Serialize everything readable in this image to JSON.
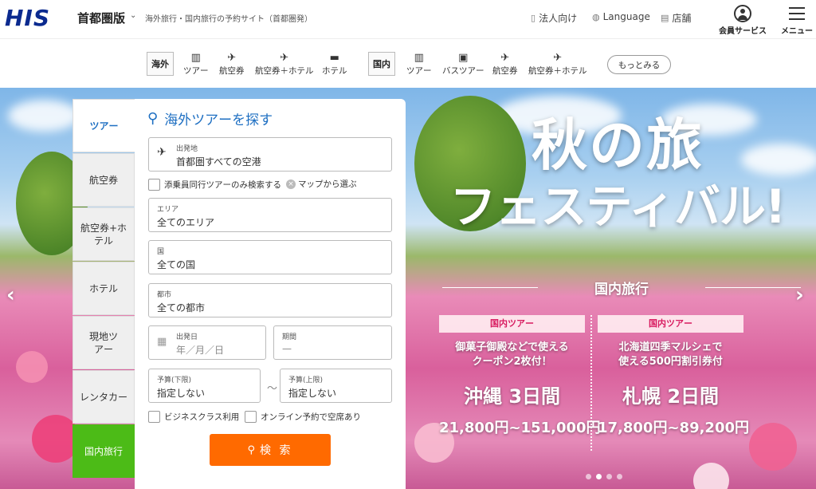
{
  "header": {
    "logo": "HIS",
    "region": "首都圏版",
    "tagline": "海外旅行・国内旅行の予約サイト（首都圏発）",
    "links": [
      {
        "label": "法人向け",
        "icon": "building-icon"
      },
      {
        "label": "Language",
        "icon": "globe-icon"
      },
      {
        "label": "店舗",
        "icon": "store-icon"
      }
    ],
    "member_label": "会員サービス",
    "menu_label": "メニュー"
  },
  "subnav": {
    "overseas_label": "海外",
    "overseas_items": [
      "ツアー",
      "航空券",
      "航空券＋ホテル",
      "ホテル"
    ],
    "domestic_label": "国内",
    "domestic_items": [
      "ツアー",
      "バスツアー",
      "航空券",
      "航空券＋ホテル"
    ],
    "more_label": "もっとみる"
  },
  "search": {
    "tabs": [
      "ツアー",
      "航空券",
      "航空券+ホテル",
      "ホテル",
      "現地ツアー",
      "レンタカー",
      "国内旅行"
    ],
    "active_tab": "ツアー",
    "title": "海外ツアーを探す",
    "departure": {
      "label": "出発地",
      "value": "首都圏すべての空港"
    },
    "conductor_only": "添乗員同行ツアーのみ検索する",
    "map_link": "マップから選ぶ",
    "area": {
      "label": "エリア",
      "value": "全てのエリア"
    },
    "country": {
      "label": "国",
      "value": "全ての国"
    },
    "city": {
      "label": "都市",
      "value": "全ての都市"
    },
    "date": {
      "label": "出発日",
      "placeholder": "年／月／日"
    },
    "period": {
      "label": "期間",
      "value": "—"
    },
    "budget_min": {
      "label": "予算(下限)",
      "value": "指定しない"
    },
    "budget_max": {
      "label": "予算(上限)",
      "value": "指定しない"
    },
    "budget_separator": "～",
    "business_class": "ビジネスクラス利用",
    "online_available": "オンライン予約で空席あり",
    "search_button": "検 索"
  },
  "hero": {
    "title_line1": "秋の旅",
    "title_line2": "フェスティバル!",
    "subtitle": "国内旅行",
    "offers": [
      {
        "badge": "国内ツアー",
        "desc_line1": "御菓子御殿などで使える",
        "desc_line2": "クーポン2枚付！",
        "dest": "沖縄 3日間",
        "price": "21,800円~151,000円"
      },
      {
        "badge": "国内ツアー",
        "desc_line1": "北海道四季マルシェで",
        "desc_line2": "使える500円割引券付",
        "dest": "札幌 2日間",
        "price": "17,800円~89,200円"
      }
    ],
    "slide_count": 4,
    "active_slide": 1
  },
  "colors": {
    "brand": "#0b2a8f",
    "accent_blue": "#1e6fc2",
    "search_button": "#ff6a00",
    "domestic_tab": "#4cbb17",
    "promo_badge_text": "#d81b60"
  }
}
